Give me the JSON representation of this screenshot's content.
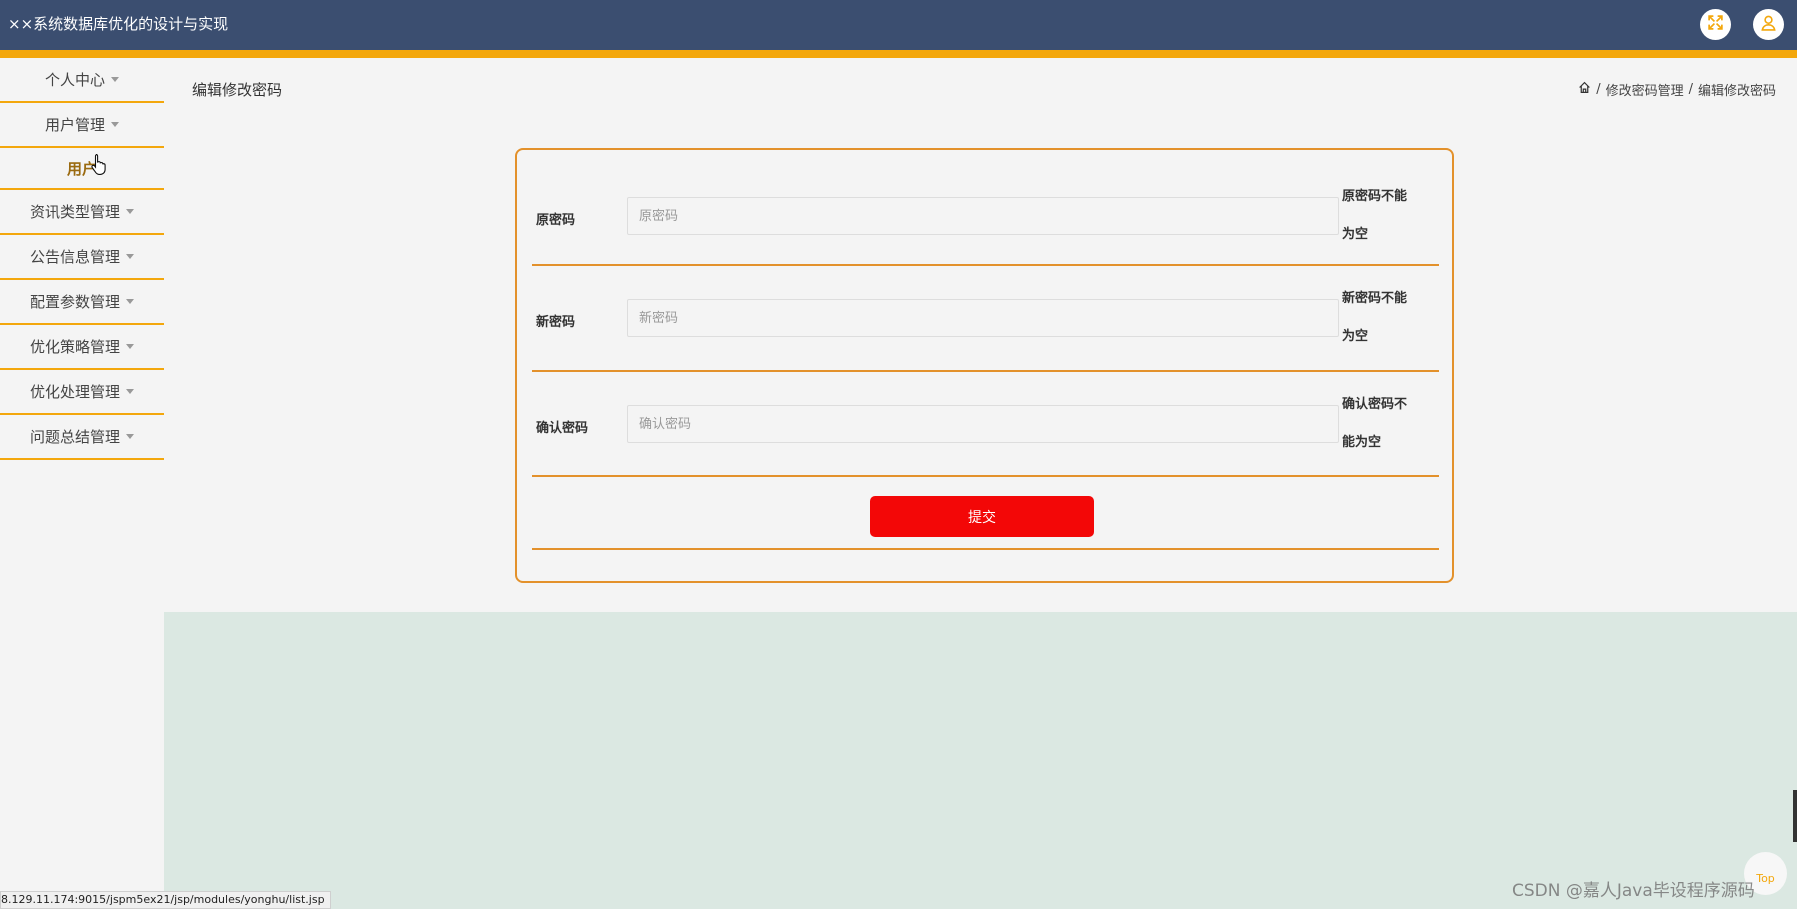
{
  "header": {
    "title": "××系统数据库优化的设计与实现",
    "fullscreen_icon": "expand-icon",
    "user_icon": "user-icon"
  },
  "sidebar": {
    "items": [
      {
        "label": "个人中心"
      },
      {
        "label": "用户管理"
      },
      {
        "label": "用户",
        "sub": true
      },
      {
        "label": "资讯类型管理"
      },
      {
        "label": "公告信息管理"
      },
      {
        "label": "配置参数管理"
      },
      {
        "label": "优化策略管理"
      },
      {
        "label": "优化处理管理"
      },
      {
        "label": "问题总结管理"
      }
    ]
  },
  "page": {
    "title": "编辑修改密码",
    "breadcrumb": [
      "修改密码管理",
      "编辑修改密码"
    ]
  },
  "form": {
    "fields": [
      {
        "label": "原密码",
        "placeholder": "原密码",
        "value": "",
        "error_line1": "原密码不能",
        "error_line2": "为空"
      },
      {
        "label": "新密码",
        "placeholder": "新密码",
        "value": "",
        "error_line1": "新密码不能",
        "error_line2": "为空"
      },
      {
        "label": "确认密码",
        "placeholder": "确认密码",
        "value": "",
        "error_line1": "确认密码不",
        "error_line2": "能为空"
      }
    ],
    "submit_label": "提交"
  },
  "status_bar": {
    "url": "8.129.11.174:9015/jspm5ex21/jsp/modules/yonghu/list.jsp"
  },
  "watermark": "CSDN @嘉人Java毕设程序源码",
  "back_to_top_label": "Top",
  "colors": {
    "header_bg": "#3b4e70",
    "accent": "#f3a70c",
    "card_border": "#e3912b",
    "submit_bg": "#f30707",
    "content_bg": "#dbe8e2"
  }
}
